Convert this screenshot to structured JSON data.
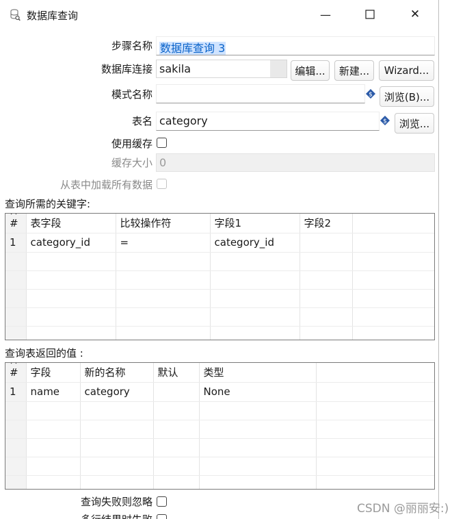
{
  "window": {
    "title": "数据库查询",
    "minimize_glyph": "—",
    "close_glyph": "✕"
  },
  "fields": {
    "step_name_label": "步骤名称",
    "step_name_value": "数据库查询 3",
    "connection_label": "数据库连接",
    "connection_value": "sakila",
    "edit_button": "编辑...",
    "new_button": "新建...",
    "wizard_button": "Wizard...",
    "schema_label": "模式名称",
    "schema_value": "",
    "schema_browse_button": "浏览(B)...",
    "table_label": "表名",
    "table_value": "category",
    "table_browse_button": "浏览...",
    "use_cache_label": "使用缓存",
    "cache_size_label": "缓存大小",
    "cache_size_value": "0",
    "load_all_label": "从表中加载所有数据"
  },
  "keys_section": {
    "title": "查询所需的关键字:",
    "columns": [
      "#",
      "表字段",
      "比较操作符",
      "字段1",
      "字段2",
      ""
    ],
    "rows": [
      [
        "1",
        "category_id",
        "=",
        "category_id",
        "",
        ""
      ],
      [
        "",
        "",
        "",
        "",
        "",
        ""
      ],
      [
        "",
        "",
        "",
        "",
        "",
        ""
      ],
      [
        "",
        "",
        "",
        "",
        "",
        ""
      ],
      [
        "",
        "",
        "",
        "",
        "",
        ""
      ],
      [
        "",
        "",
        "",
        "",
        "",
        ""
      ]
    ]
  },
  "return_section": {
    "title": "查询表返回的值 :",
    "columns": [
      "#",
      "字段",
      "新的名称",
      "默认",
      "类型",
      ""
    ],
    "rows": [
      [
        "1",
        "name",
        "category",
        "",
        "None",
        ""
      ],
      [
        "",
        "",
        "",
        "",
        "",
        ""
      ],
      [
        "",
        "",
        "",
        "",
        "",
        ""
      ],
      [
        "",
        "",
        "",
        "",
        "",
        ""
      ],
      [
        "",
        "",
        "",
        "",
        "",
        ""
      ],
      [
        "",
        "",
        "",
        "",
        "",
        ""
      ]
    ]
  },
  "bottom": {
    "fail_ignore_label": "查询失败则忽略",
    "multi_result_label": "多行结果时失败"
  },
  "watermark": "CSDN @丽丽安:)",
  "colors": {
    "selection_bg": "#cfe3ff",
    "selection_text": "#0a63c9",
    "diamond_icon": "#2b5aa8"
  }
}
